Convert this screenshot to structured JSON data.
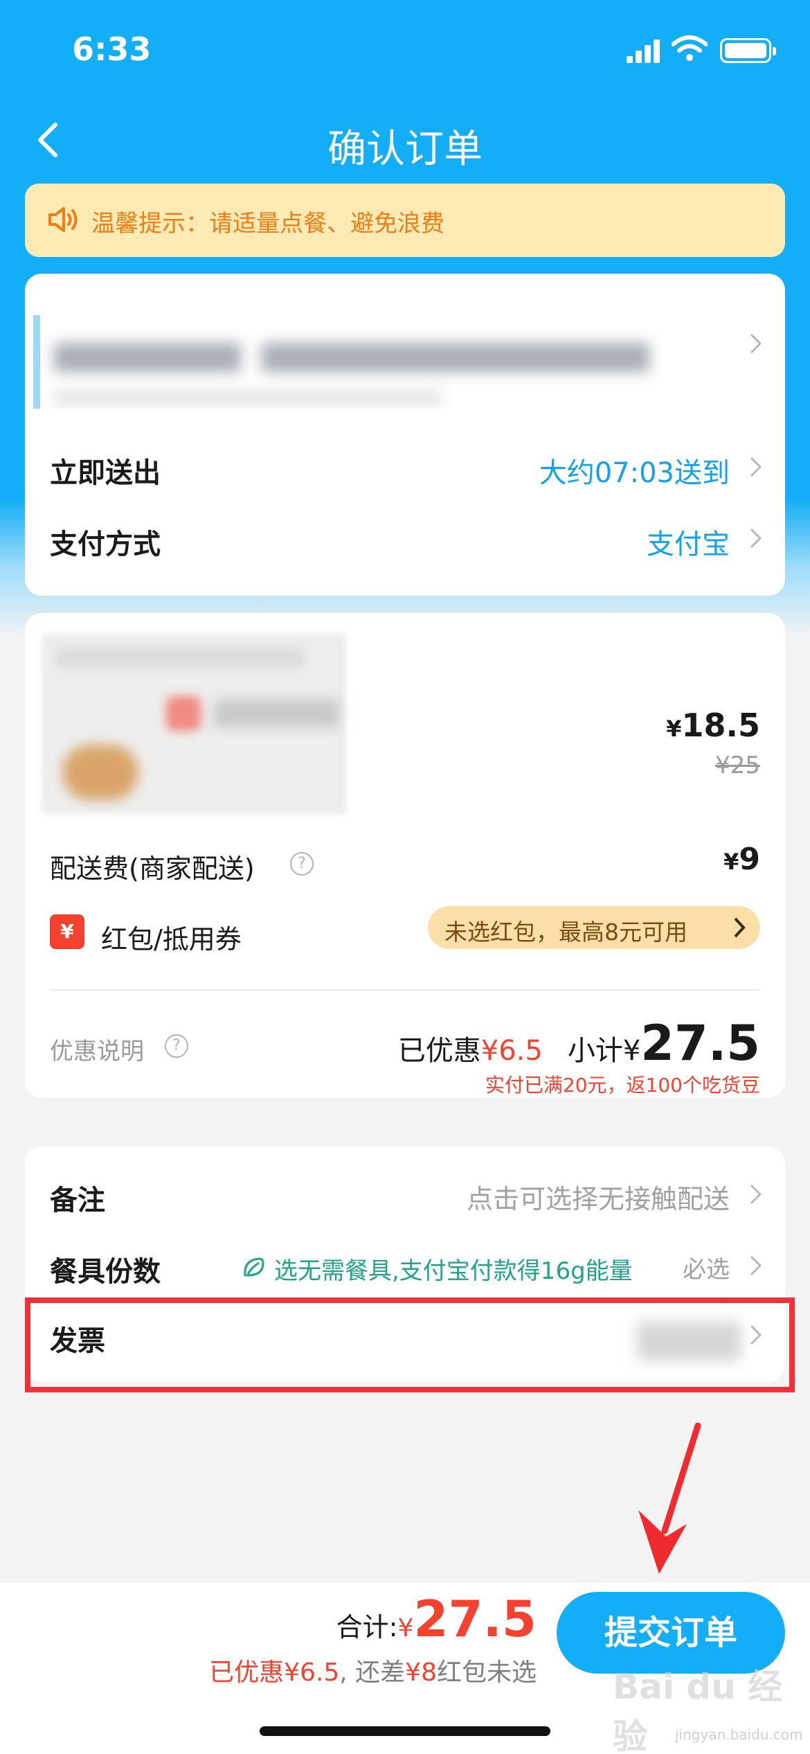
{
  "status_bar": {
    "time": "6:33"
  },
  "nav": {
    "title": "确认订单"
  },
  "tip": {
    "text": "温馨提示：请适量点餐、避免浪费"
  },
  "delivery": {
    "time_label": "立即送出",
    "time_value": "大约07:03送到",
    "pay_label": "支付方式",
    "pay_value": "支付宝"
  },
  "order": {
    "item_price_symbol": "¥",
    "item_price": "18.5",
    "item_original_price": "¥25",
    "fee_label": "配送费(商家配送)",
    "fee_symbol": "¥",
    "fee_value": "9",
    "redpacket_icon": "¥",
    "redpacket_label": "红包/抵用券",
    "redpacket_pill": "未选红包，最高8元可用",
    "discount_label": "优惠说明",
    "discount_prefix": "已优惠",
    "discount_value": "¥6.5",
    "subtotal_prefix": "小计",
    "subtotal_symbol": "¥",
    "subtotal_value": "27.5",
    "discount_note": "实付已满20元，返100个吃货豆"
  },
  "extras": {
    "remark_label": "备注",
    "remark_hint": "点击可选择无接触配送",
    "tableware_label": "餐具份数",
    "tableware_promo": "选无需餐具,支付宝付款得16g能量",
    "tableware_required": "必选",
    "invoice_label": "发票"
  },
  "footer": {
    "total_label": "合计:",
    "total_symbol": "¥",
    "total_value": "27.5",
    "note_discount": "已优惠¥6.5",
    "note_rest": ", 还差",
    "note_amount": "¥8",
    "note_tail": "红包未选",
    "submit_label": "提交订单"
  },
  "watermark": {
    "logo": "Bai du 经验",
    "url": "jingyan.baidu.com"
  },
  "colors": {
    "accent": "#13aef7",
    "price_red": "#f5412d",
    "highlight": "#ef3236",
    "promo_green": "#1fa48a"
  }
}
